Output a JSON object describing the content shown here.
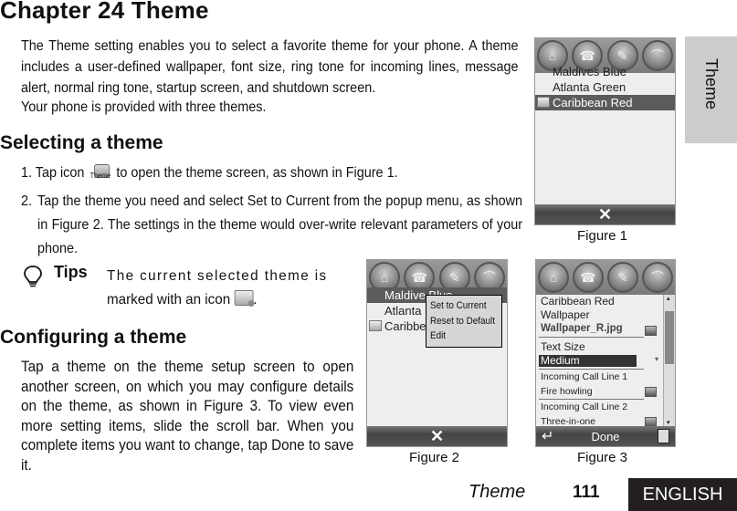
{
  "chapter_title": "Chapter 24 Theme",
  "intro": {
    "p1": "The Theme setting enables you to select a favorite theme for your phone. A theme includes a user-defined wallpaper, font size, ring tone for incoming lines, message alert, normal ring tone, startup screen, and shutdown screen.",
    "p2": "Your phone is provided with three themes."
  },
  "selecting": {
    "heading": "Selecting a theme",
    "step1_num": "1.",
    "step1_pre": "Tap icon",
    "step1_icon_caption": "Theme",
    "step1_post": "to open the theme screen, as shown in Figure 1.",
    "step2_num": "2.",
    "step2_text": "Tap the theme you need and select Set to Current from the popup menu, as shown in Figure 2. The settings in the theme would over-write relevant parameters of your phone."
  },
  "tips": {
    "label": "Tips",
    "line1": "The current selected theme is",
    "line2_pre": "marked with an icon",
    "line2_post": "."
  },
  "configuring": {
    "heading": "Configuring a theme",
    "text": "Tap a theme on the theme setup screen to open another screen, on which you may configure details on the theme, as shown in Figure 3. To view even more setting items, slide the scroll bar. When you complete items you want to change, tap Done to save it."
  },
  "phone_topbar_icons": [
    "home-icon",
    "phone-icon",
    "contacts-icon",
    "hangup-icon"
  ],
  "figure1": {
    "caption": "Figure 1",
    "themes": [
      "Maldives Blue",
      "Atlanta Green",
      "Caribbean Red"
    ],
    "selected": "Caribbean Red",
    "close_glyph": "✕"
  },
  "figure2": {
    "caption": "Figure 2",
    "themes_visible": [
      "Maldive Blue",
      "Atlanta",
      "Caribbe"
    ],
    "popup_menu": [
      "Set to Current",
      "Reset to Default",
      "Edit"
    ],
    "close_glyph": "✕"
  },
  "figure3": {
    "caption": "Figure 3",
    "theme_name": "Caribbean Red",
    "wallpaper_label": "Wallpaper",
    "wallpaper_value": "Wallpaper_R.jpg",
    "text_size_label": "Text Size",
    "text_size_value": "Medium",
    "line1_label": "Incoming Call Line 1",
    "line1_value": "Fire howling",
    "line2_label": "Incoming Call Line 2",
    "line2_value": "Three-in-one",
    "done_label": "Done",
    "back_glyph": "↵"
  },
  "side_tab": "Theme",
  "footer": {
    "section": "Theme",
    "page": "111",
    "language": "ENGLISH"
  },
  "colors": {
    "footer_lang_bg": "#231f20",
    "side_tab_bg": "#cccccc",
    "selected_row_bg": "#5b5b5b"
  }
}
